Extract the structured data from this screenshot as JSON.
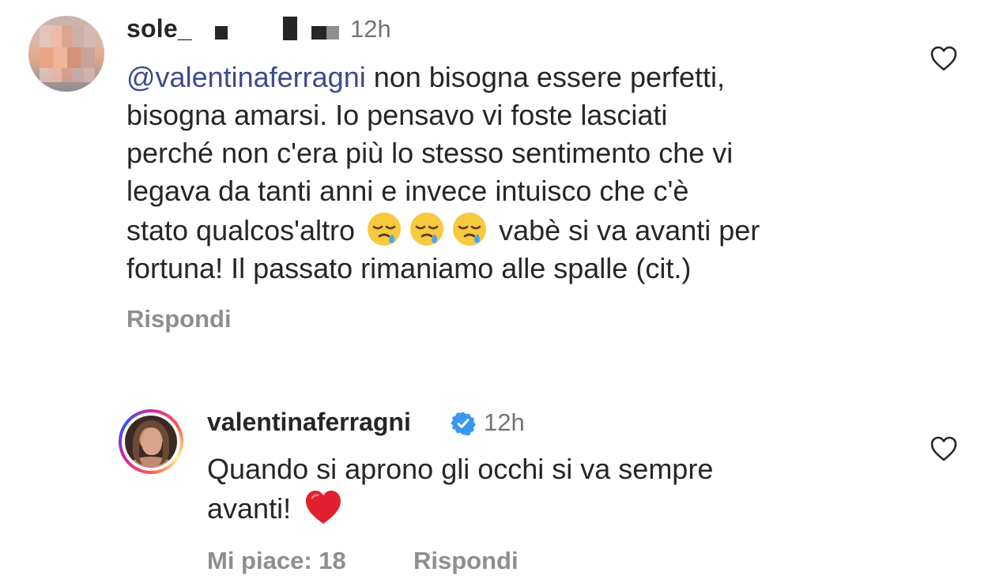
{
  "comments": [
    {
      "username": "sole_",
      "time": "12h",
      "mention": "@valentinaferragni",
      "text_lines": [
        " non bisogna essere perfetti,",
        "bisogna amarsi. Io pensavo vi foste lasciati",
        "perché non c'era più lo stesso sentimento che vi",
        "legava da tanti anni e invece intuisco che c'è",
        "stato qualcos'altro",
        " vabè si va avanti per",
        "fortuna! Il passato rimaniamo alle spalle (cit.)"
      ],
      "emojis": [
        "sleepy-face",
        "sleepy-face",
        "sleepy-face"
      ],
      "reply_label": "Rispondi",
      "avatar_blurred": true
    },
    {
      "username": "valentinaferragni",
      "verified": true,
      "time": "12h",
      "text_lines": [
        "Quando si aprono gli occhi si va sempre",
        "avanti!"
      ],
      "emoji": "red-heart",
      "likes_label": "Mi piace: 18",
      "reply_label": "Rispondi",
      "story_ring": true
    }
  ],
  "colors": {
    "text": "#262626",
    "secondary": "#8e8e8e",
    "timestamp": "#737373",
    "mention": "#3a4c8a",
    "verified": "#3897f0",
    "heart": "#e0202e"
  },
  "icons": {
    "like": "heart-outline-icon",
    "verified": "verified-badge-icon"
  }
}
